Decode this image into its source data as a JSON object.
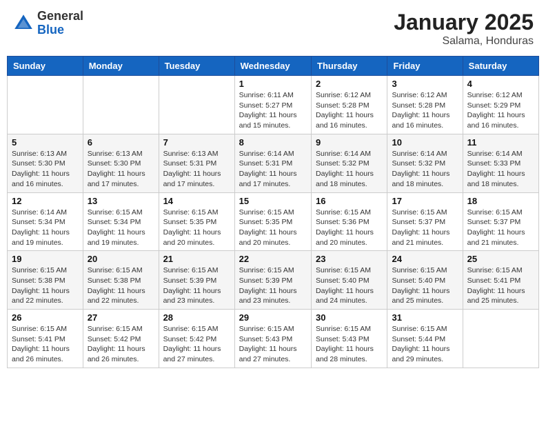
{
  "header": {
    "logo_general": "General",
    "logo_blue": "Blue",
    "month_title": "January 2025",
    "location": "Salama, Honduras"
  },
  "days_of_week": [
    "Sunday",
    "Monday",
    "Tuesday",
    "Wednesday",
    "Thursday",
    "Friday",
    "Saturday"
  ],
  "weeks": [
    [
      {
        "day": "",
        "info": ""
      },
      {
        "day": "",
        "info": ""
      },
      {
        "day": "",
        "info": ""
      },
      {
        "day": "1",
        "info": "Sunrise: 6:11 AM\nSunset: 5:27 PM\nDaylight: 11 hours and 15 minutes."
      },
      {
        "day": "2",
        "info": "Sunrise: 6:12 AM\nSunset: 5:28 PM\nDaylight: 11 hours and 16 minutes."
      },
      {
        "day": "3",
        "info": "Sunrise: 6:12 AM\nSunset: 5:28 PM\nDaylight: 11 hours and 16 minutes."
      },
      {
        "day": "4",
        "info": "Sunrise: 6:12 AM\nSunset: 5:29 PM\nDaylight: 11 hours and 16 minutes."
      }
    ],
    [
      {
        "day": "5",
        "info": "Sunrise: 6:13 AM\nSunset: 5:30 PM\nDaylight: 11 hours and 16 minutes."
      },
      {
        "day": "6",
        "info": "Sunrise: 6:13 AM\nSunset: 5:30 PM\nDaylight: 11 hours and 17 minutes."
      },
      {
        "day": "7",
        "info": "Sunrise: 6:13 AM\nSunset: 5:31 PM\nDaylight: 11 hours and 17 minutes."
      },
      {
        "day": "8",
        "info": "Sunrise: 6:14 AM\nSunset: 5:31 PM\nDaylight: 11 hours and 17 minutes."
      },
      {
        "day": "9",
        "info": "Sunrise: 6:14 AM\nSunset: 5:32 PM\nDaylight: 11 hours and 18 minutes."
      },
      {
        "day": "10",
        "info": "Sunrise: 6:14 AM\nSunset: 5:32 PM\nDaylight: 11 hours and 18 minutes."
      },
      {
        "day": "11",
        "info": "Sunrise: 6:14 AM\nSunset: 5:33 PM\nDaylight: 11 hours and 18 minutes."
      }
    ],
    [
      {
        "day": "12",
        "info": "Sunrise: 6:14 AM\nSunset: 5:34 PM\nDaylight: 11 hours and 19 minutes."
      },
      {
        "day": "13",
        "info": "Sunrise: 6:15 AM\nSunset: 5:34 PM\nDaylight: 11 hours and 19 minutes."
      },
      {
        "day": "14",
        "info": "Sunrise: 6:15 AM\nSunset: 5:35 PM\nDaylight: 11 hours and 20 minutes."
      },
      {
        "day": "15",
        "info": "Sunrise: 6:15 AM\nSunset: 5:35 PM\nDaylight: 11 hours and 20 minutes."
      },
      {
        "day": "16",
        "info": "Sunrise: 6:15 AM\nSunset: 5:36 PM\nDaylight: 11 hours and 20 minutes."
      },
      {
        "day": "17",
        "info": "Sunrise: 6:15 AM\nSunset: 5:37 PM\nDaylight: 11 hours and 21 minutes."
      },
      {
        "day": "18",
        "info": "Sunrise: 6:15 AM\nSunset: 5:37 PM\nDaylight: 11 hours and 21 minutes."
      }
    ],
    [
      {
        "day": "19",
        "info": "Sunrise: 6:15 AM\nSunset: 5:38 PM\nDaylight: 11 hours and 22 minutes."
      },
      {
        "day": "20",
        "info": "Sunrise: 6:15 AM\nSunset: 5:38 PM\nDaylight: 11 hours and 22 minutes."
      },
      {
        "day": "21",
        "info": "Sunrise: 6:15 AM\nSunset: 5:39 PM\nDaylight: 11 hours and 23 minutes."
      },
      {
        "day": "22",
        "info": "Sunrise: 6:15 AM\nSunset: 5:39 PM\nDaylight: 11 hours and 23 minutes."
      },
      {
        "day": "23",
        "info": "Sunrise: 6:15 AM\nSunset: 5:40 PM\nDaylight: 11 hours and 24 minutes."
      },
      {
        "day": "24",
        "info": "Sunrise: 6:15 AM\nSunset: 5:40 PM\nDaylight: 11 hours and 25 minutes."
      },
      {
        "day": "25",
        "info": "Sunrise: 6:15 AM\nSunset: 5:41 PM\nDaylight: 11 hours and 25 minutes."
      }
    ],
    [
      {
        "day": "26",
        "info": "Sunrise: 6:15 AM\nSunset: 5:41 PM\nDaylight: 11 hours and 26 minutes."
      },
      {
        "day": "27",
        "info": "Sunrise: 6:15 AM\nSunset: 5:42 PM\nDaylight: 11 hours and 26 minutes."
      },
      {
        "day": "28",
        "info": "Sunrise: 6:15 AM\nSunset: 5:42 PM\nDaylight: 11 hours and 27 minutes."
      },
      {
        "day": "29",
        "info": "Sunrise: 6:15 AM\nSunset: 5:43 PM\nDaylight: 11 hours and 27 minutes."
      },
      {
        "day": "30",
        "info": "Sunrise: 6:15 AM\nSunset: 5:43 PM\nDaylight: 11 hours and 28 minutes."
      },
      {
        "day": "31",
        "info": "Sunrise: 6:15 AM\nSunset: 5:44 PM\nDaylight: 11 hours and 29 minutes."
      },
      {
        "day": "",
        "info": ""
      }
    ]
  ]
}
